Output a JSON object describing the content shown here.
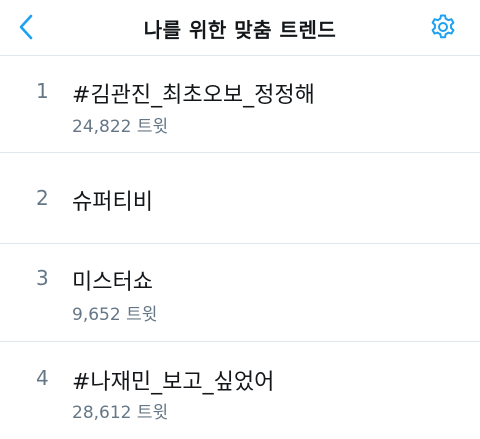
{
  "header": {
    "title": "나를 위한 맞춤 트렌드",
    "back_icon": "chevron-left-icon",
    "settings_icon": "gear-icon"
  },
  "colors": {
    "accent": "#1da1f2",
    "text": "#14171a",
    "secondary": "#657786",
    "divider": "#e1e8ed"
  },
  "trends": [
    {
      "rank": "1",
      "name": "#김관진_최초오보_정정해",
      "count": "24,822 트윗"
    },
    {
      "rank": "2",
      "name": "슈퍼티비"
    },
    {
      "rank": "3",
      "name": "미스터쇼",
      "count": "9,652 트윗"
    },
    {
      "rank": "4",
      "name": "#나재민_보고_싶었어",
      "count": "28,612 트윗"
    }
  ]
}
